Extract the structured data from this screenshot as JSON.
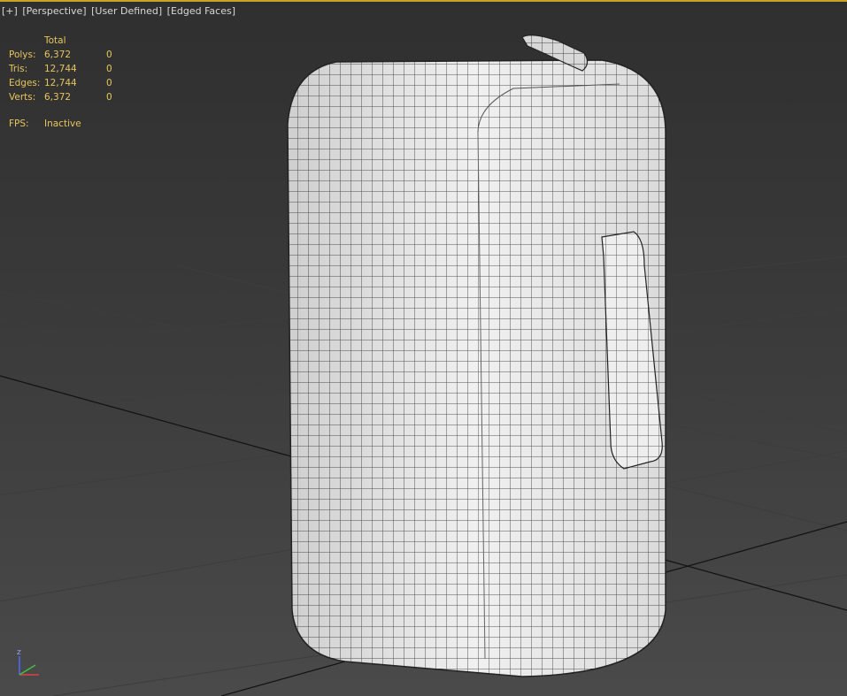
{
  "viewport": {
    "labels": [
      "[+]",
      "[Perspective]",
      "[User Defined]",
      "[Edged Faces]"
    ]
  },
  "stats": {
    "header": "Total",
    "rows": [
      {
        "label": "Polys:",
        "total": "6,372",
        "selected": "0"
      },
      {
        "label": "Tris:",
        "total": "12,744",
        "selected": "0"
      },
      {
        "label": "Edges:",
        "total": "12,744",
        "selected": "0"
      },
      {
        "label": "Verts:",
        "total": "6,372",
        "selected": "0"
      }
    ],
    "fps_label": "FPS:",
    "fps_value": "Inactive"
  },
  "gizmo": {
    "axis_label": "z"
  },
  "colors": {
    "accent": "#e8c65a",
    "border": "#c9a227",
    "mesh": "#e6e6e6",
    "wire": "#1a1a1a"
  }
}
